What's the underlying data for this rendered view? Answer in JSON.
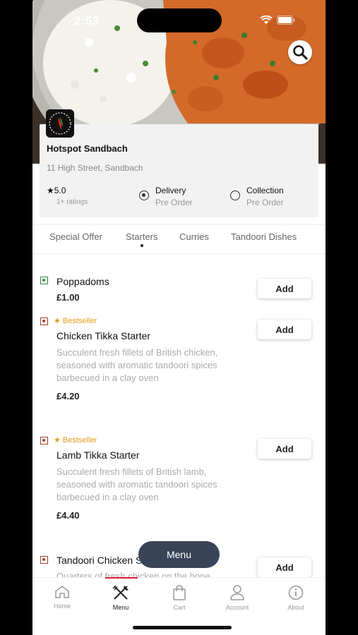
{
  "status_bar": {
    "time": "2:53"
  },
  "restaurant": {
    "name": "Hotspot Sandbach",
    "address": "11 High Street, Sandbach",
    "rating": "5.0",
    "rating_count": "1+ ratings"
  },
  "order_options": [
    {
      "label": "Delivery",
      "sub": "Pre Order",
      "selected": true
    },
    {
      "label": "Collection",
      "sub": "Pre Order",
      "selected": false
    }
  ],
  "categories": [
    "Special Offer",
    "Starters",
    "Curries",
    "Tandoori Dishes"
  ],
  "active_category": "Starters",
  "items": [
    {
      "name": "Poppadoms",
      "price": "£1.00",
      "badge": "",
      "description": "",
      "add_label": "Add",
      "mark_color": "#2e8b3a"
    },
    {
      "name": "Chicken Tikka Starter",
      "price": "£4.20",
      "badge": "Bestseller",
      "description": "Succulent fresh fillets of British chicken, seasoned with aromatic tandoori spices barbecued in a clay oven",
      "add_label": "Add",
      "mark_color": "#a0432b"
    },
    {
      "name": "Lamb Tikka Starter",
      "price": "£4.40",
      "badge": "Bestseller",
      "description": "Succulent fresh fillets of British lamb, seasoned with aromatic tandoori spices barbecued in a clay oven",
      "add_label": "Add",
      "mark_color": "#a0432b"
    },
    {
      "name": "Tandoori Chicken S",
      "price": "",
      "badge": "",
      "description": "Quarters of fresh chicken on the bone",
      "add_label": "Add",
      "mark_color": "#a0432b"
    }
  ],
  "menu_button": "Menu",
  "bottom_nav": [
    {
      "label": "Home",
      "icon": "home-icon"
    },
    {
      "label": "Menu",
      "icon": "cutlery-icon"
    },
    {
      "label": "Cart",
      "icon": "bag-icon"
    },
    {
      "label": "Account",
      "icon": "person-icon"
    },
    {
      "label": "About",
      "icon": "info-icon"
    }
  ],
  "colors": {
    "accent": "#3a4458",
    "bestseller": "#e39a1b",
    "veg": "#2e8b3a",
    "nonveg": "#a0432b"
  }
}
